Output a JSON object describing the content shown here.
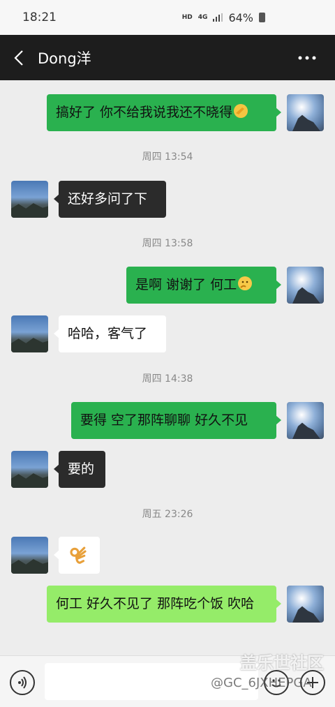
{
  "status": {
    "time": "18:21",
    "hd": "HD",
    "net": "4G",
    "battery": "64%"
  },
  "header": {
    "title": "Dong洋",
    "more": "···"
  },
  "messages": [
    {
      "side": "right",
      "text": "搞好了 你不给我说我还不晓得",
      "emoji": "ok-hand"
    },
    {
      "type": "time",
      "text": "周四 13:54"
    },
    {
      "side": "left",
      "text": "还好多问了下"
    },
    {
      "type": "time",
      "text": "周四 13:58"
    },
    {
      "side": "right",
      "text": "是啊 谢谢了 何工",
      "emoji": "thinking"
    },
    {
      "side": "left",
      "text": "哈哈，客气了"
    },
    {
      "type": "time",
      "text": "周四 14:38"
    },
    {
      "side": "right",
      "text": "要得 空了那阵聊聊 好久不见"
    },
    {
      "side": "left",
      "text": "要的"
    },
    {
      "type": "time",
      "text": "周五 23:26"
    },
    {
      "side": "left",
      "emoji": "ok-gesture"
    },
    {
      "side": "right",
      "text": "何工 好久不见了 那阵吃个饭 吹哈"
    }
  ],
  "watermark": {
    "title": "盖乐世社区",
    "handle": "@GC_6JXHEPGA"
  }
}
